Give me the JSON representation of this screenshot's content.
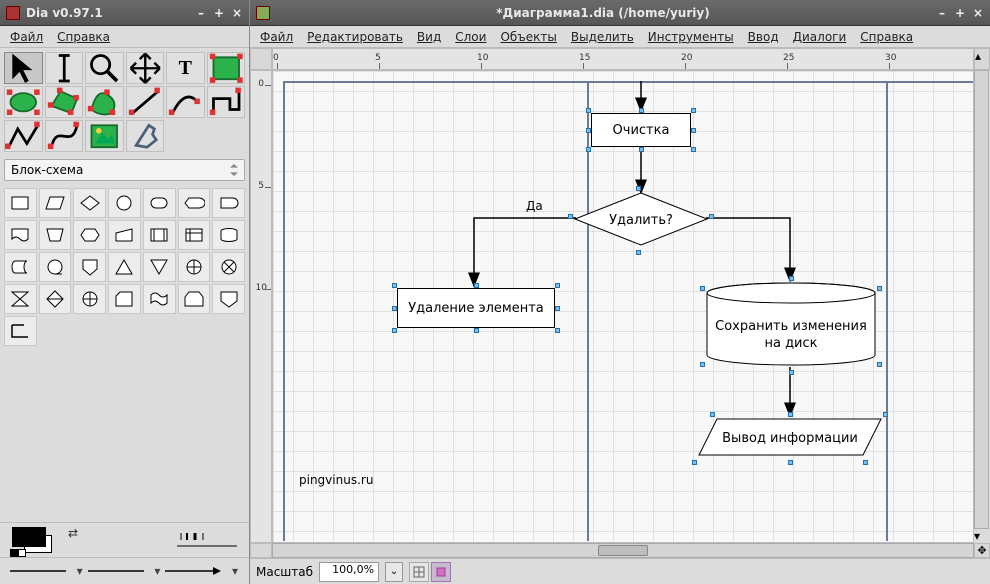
{
  "toolbox": {
    "title": "Dia v0.97.1",
    "menu": {
      "file": "Файл",
      "help": "Справка"
    },
    "sheet_name": "Блок-схема"
  },
  "editor": {
    "title": "*Диаграмма1.dia (/home/yuriy)",
    "menu": {
      "file": "Файл",
      "edit": "Редактировать",
      "view": "Вид",
      "layers": "Слои",
      "objects": "Объекты",
      "select": "Выделить",
      "tools": "Инструменты",
      "input": "Ввод",
      "dialogs": "Диалоги",
      "help": "Справка"
    },
    "ruler_h": [
      "0",
      "5",
      "10",
      "15",
      "20",
      "25",
      "30"
    ],
    "ruler_v": [
      "0",
      "5",
      "10"
    ],
    "watermark": "pingvinus.ru",
    "flow": {
      "clear": "Очистка",
      "decision": "Удалить?",
      "yes": "Да",
      "delete_elem": "Удаление элемента",
      "save_disk_l1": "Сохранить изменения",
      "save_disk_l2": "на диск",
      "output": "Вывод информации"
    },
    "status": {
      "zoom_label": "Масштаб",
      "zoom_value": "100,0%"
    }
  }
}
